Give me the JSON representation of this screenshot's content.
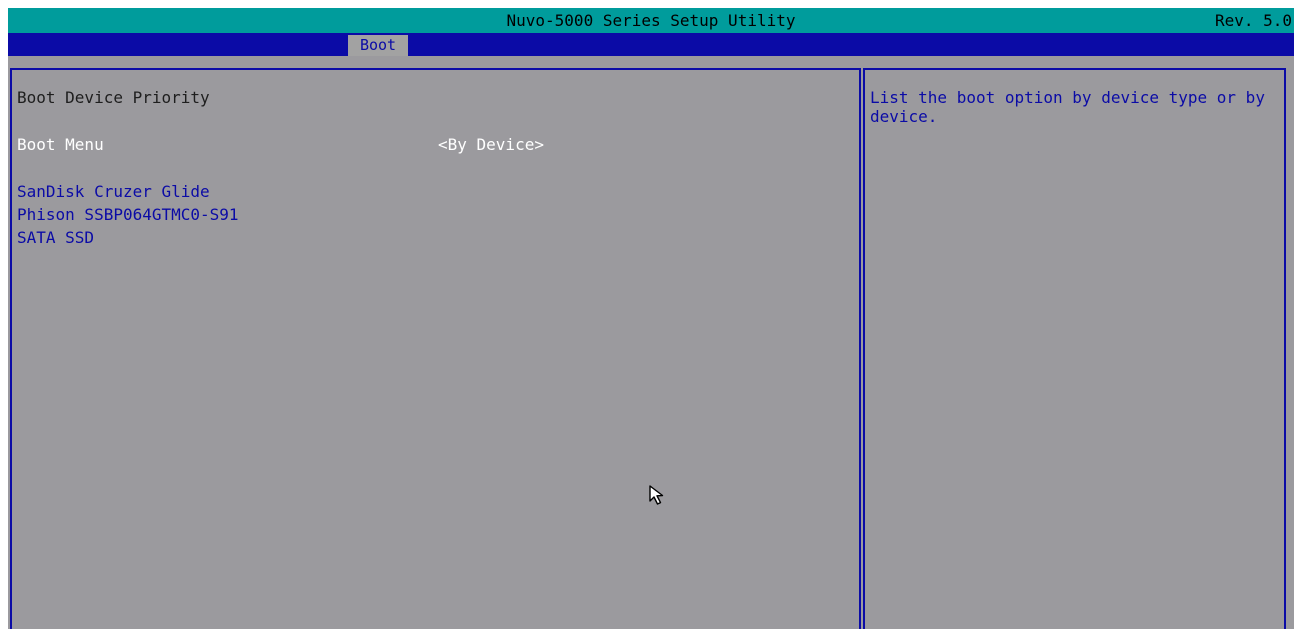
{
  "header": {
    "title": "Nuvo-5000 Series Setup Utility",
    "revision": "Rev. 5.0"
  },
  "tabs": [
    {
      "label": "Boot",
      "active": true
    }
  ],
  "main": {
    "section_title": "Boot Device Priority",
    "boot_menu": {
      "label": "Boot Menu",
      "value": "<By Device>"
    },
    "boot_devices": [
      "SanDisk Cruzer Glide",
      "Phison SSBP064GTMC0-S91",
      "SATA SSD"
    ]
  },
  "help": {
    "text": "List the boot option by device type or by device."
  },
  "colors": {
    "title_bar": "#009c9c",
    "tab_bar": "#0b0ba6",
    "panel_bg": "#9b9a9e",
    "accent_text": "#0b0ba6",
    "selected_text": "#ffffff"
  },
  "icons": {
    "pointer": "mouse-pointer-icon"
  }
}
